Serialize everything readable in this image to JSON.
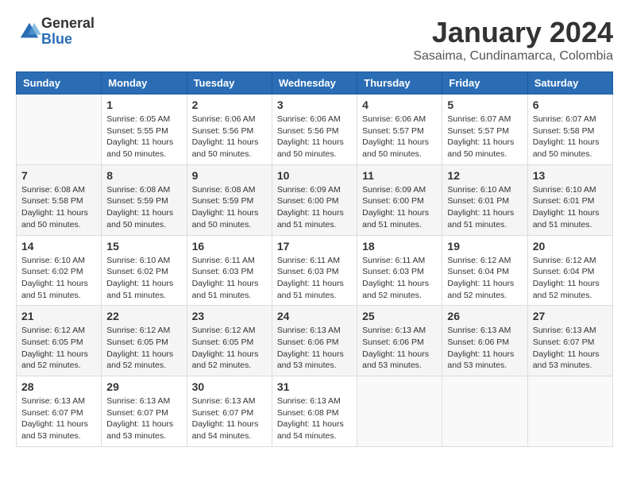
{
  "header": {
    "logo_general": "General",
    "logo_blue": "Blue",
    "month_title": "January 2024",
    "location": "Sasaima, Cundinamarca, Colombia"
  },
  "weekdays": [
    "Sunday",
    "Monday",
    "Tuesday",
    "Wednesday",
    "Thursday",
    "Friday",
    "Saturday"
  ],
  "weeks": [
    [
      {
        "day": "",
        "sunrise": "",
        "sunset": "",
        "daylight": ""
      },
      {
        "day": "1",
        "sunrise": "Sunrise: 6:05 AM",
        "sunset": "Sunset: 5:55 PM",
        "daylight": "Daylight: 11 hours and 50 minutes."
      },
      {
        "day": "2",
        "sunrise": "Sunrise: 6:06 AM",
        "sunset": "Sunset: 5:56 PM",
        "daylight": "Daylight: 11 hours and 50 minutes."
      },
      {
        "day": "3",
        "sunrise": "Sunrise: 6:06 AM",
        "sunset": "Sunset: 5:56 PM",
        "daylight": "Daylight: 11 hours and 50 minutes."
      },
      {
        "day": "4",
        "sunrise": "Sunrise: 6:06 AM",
        "sunset": "Sunset: 5:57 PM",
        "daylight": "Daylight: 11 hours and 50 minutes."
      },
      {
        "day": "5",
        "sunrise": "Sunrise: 6:07 AM",
        "sunset": "Sunset: 5:57 PM",
        "daylight": "Daylight: 11 hours and 50 minutes."
      },
      {
        "day": "6",
        "sunrise": "Sunrise: 6:07 AM",
        "sunset": "Sunset: 5:58 PM",
        "daylight": "Daylight: 11 hours and 50 minutes."
      }
    ],
    [
      {
        "day": "7",
        "sunrise": "Sunrise: 6:08 AM",
        "sunset": "Sunset: 5:58 PM",
        "daylight": "Daylight: 11 hours and 50 minutes."
      },
      {
        "day": "8",
        "sunrise": "Sunrise: 6:08 AM",
        "sunset": "Sunset: 5:59 PM",
        "daylight": "Daylight: 11 hours and 50 minutes."
      },
      {
        "day": "9",
        "sunrise": "Sunrise: 6:08 AM",
        "sunset": "Sunset: 5:59 PM",
        "daylight": "Daylight: 11 hours and 50 minutes."
      },
      {
        "day": "10",
        "sunrise": "Sunrise: 6:09 AM",
        "sunset": "Sunset: 6:00 PM",
        "daylight": "Daylight: 11 hours and 51 minutes."
      },
      {
        "day": "11",
        "sunrise": "Sunrise: 6:09 AM",
        "sunset": "Sunset: 6:00 PM",
        "daylight": "Daylight: 11 hours and 51 minutes."
      },
      {
        "day": "12",
        "sunrise": "Sunrise: 6:10 AM",
        "sunset": "Sunset: 6:01 PM",
        "daylight": "Daylight: 11 hours and 51 minutes."
      },
      {
        "day": "13",
        "sunrise": "Sunrise: 6:10 AM",
        "sunset": "Sunset: 6:01 PM",
        "daylight": "Daylight: 11 hours and 51 minutes."
      }
    ],
    [
      {
        "day": "14",
        "sunrise": "Sunrise: 6:10 AM",
        "sunset": "Sunset: 6:02 PM",
        "daylight": "Daylight: 11 hours and 51 minutes."
      },
      {
        "day": "15",
        "sunrise": "Sunrise: 6:10 AM",
        "sunset": "Sunset: 6:02 PM",
        "daylight": "Daylight: 11 hours and 51 minutes."
      },
      {
        "day": "16",
        "sunrise": "Sunrise: 6:11 AM",
        "sunset": "Sunset: 6:03 PM",
        "daylight": "Daylight: 11 hours and 51 minutes."
      },
      {
        "day": "17",
        "sunrise": "Sunrise: 6:11 AM",
        "sunset": "Sunset: 6:03 PM",
        "daylight": "Daylight: 11 hours and 51 minutes."
      },
      {
        "day": "18",
        "sunrise": "Sunrise: 6:11 AM",
        "sunset": "Sunset: 6:03 PM",
        "daylight": "Daylight: 11 hours and 52 minutes."
      },
      {
        "day": "19",
        "sunrise": "Sunrise: 6:12 AM",
        "sunset": "Sunset: 6:04 PM",
        "daylight": "Daylight: 11 hours and 52 minutes."
      },
      {
        "day": "20",
        "sunrise": "Sunrise: 6:12 AM",
        "sunset": "Sunset: 6:04 PM",
        "daylight": "Daylight: 11 hours and 52 minutes."
      }
    ],
    [
      {
        "day": "21",
        "sunrise": "Sunrise: 6:12 AM",
        "sunset": "Sunset: 6:05 PM",
        "daylight": "Daylight: 11 hours and 52 minutes."
      },
      {
        "day": "22",
        "sunrise": "Sunrise: 6:12 AM",
        "sunset": "Sunset: 6:05 PM",
        "daylight": "Daylight: 11 hours and 52 minutes."
      },
      {
        "day": "23",
        "sunrise": "Sunrise: 6:12 AM",
        "sunset": "Sunset: 6:05 PM",
        "daylight": "Daylight: 11 hours and 52 minutes."
      },
      {
        "day": "24",
        "sunrise": "Sunrise: 6:13 AM",
        "sunset": "Sunset: 6:06 PM",
        "daylight": "Daylight: 11 hours and 53 minutes."
      },
      {
        "day": "25",
        "sunrise": "Sunrise: 6:13 AM",
        "sunset": "Sunset: 6:06 PM",
        "daylight": "Daylight: 11 hours and 53 minutes."
      },
      {
        "day": "26",
        "sunrise": "Sunrise: 6:13 AM",
        "sunset": "Sunset: 6:06 PM",
        "daylight": "Daylight: 11 hours and 53 minutes."
      },
      {
        "day": "27",
        "sunrise": "Sunrise: 6:13 AM",
        "sunset": "Sunset: 6:07 PM",
        "daylight": "Daylight: 11 hours and 53 minutes."
      }
    ],
    [
      {
        "day": "28",
        "sunrise": "Sunrise: 6:13 AM",
        "sunset": "Sunset: 6:07 PM",
        "daylight": "Daylight: 11 hours and 53 minutes."
      },
      {
        "day": "29",
        "sunrise": "Sunrise: 6:13 AM",
        "sunset": "Sunset: 6:07 PM",
        "daylight": "Daylight: 11 hours and 53 minutes."
      },
      {
        "day": "30",
        "sunrise": "Sunrise: 6:13 AM",
        "sunset": "Sunset: 6:07 PM",
        "daylight": "Daylight: 11 hours and 54 minutes."
      },
      {
        "day": "31",
        "sunrise": "Sunrise: 6:13 AM",
        "sunset": "Sunset: 6:08 PM",
        "daylight": "Daylight: 11 hours and 54 minutes."
      },
      {
        "day": "",
        "sunrise": "",
        "sunset": "",
        "daylight": ""
      },
      {
        "day": "",
        "sunrise": "",
        "sunset": "",
        "daylight": ""
      },
      {
        "day": "",
        "sunrise": "",
        "sunset": "",
        "daylight": ""
      }
    ]
  ]
}
